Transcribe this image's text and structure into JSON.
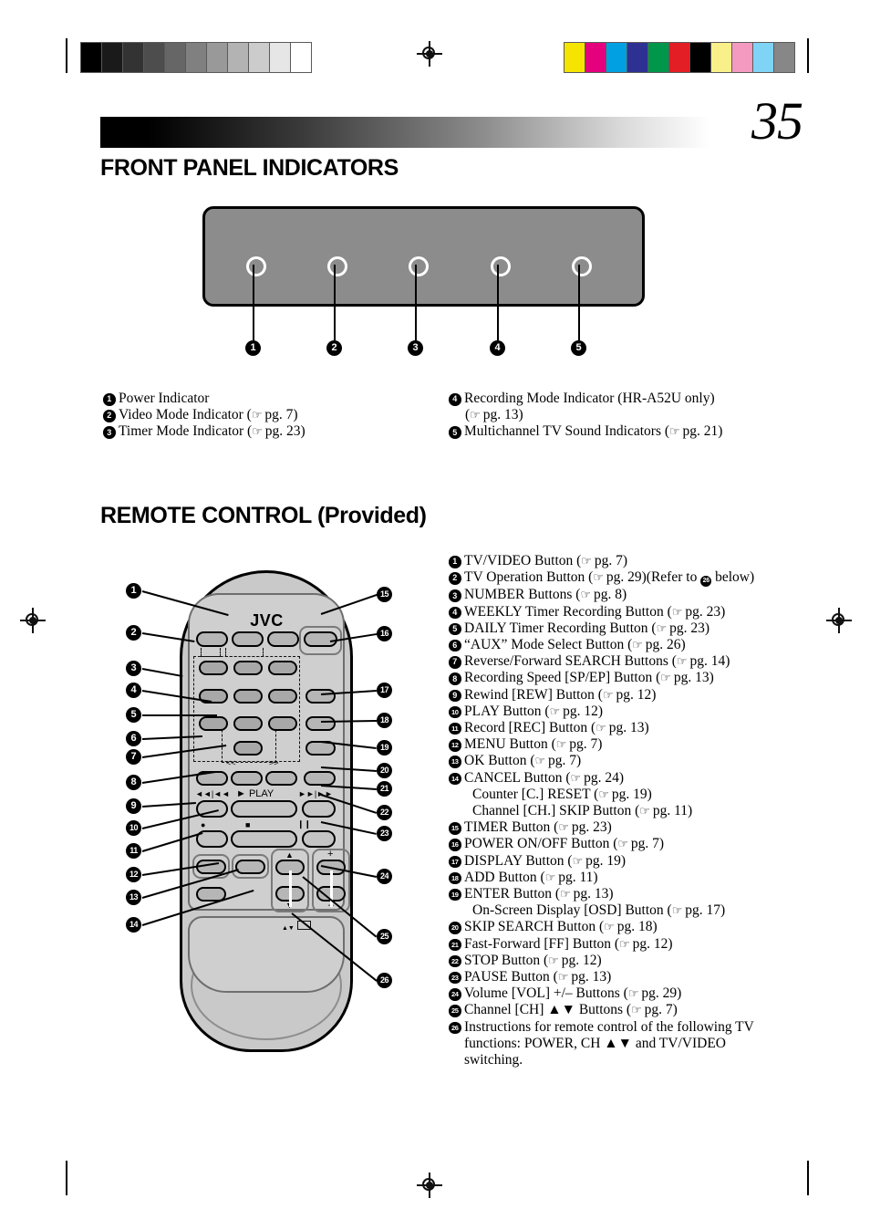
{
  "page": {
    "number": "35",
    "sections": {
      "front_panel_title": "FRONT PANEL INDICATORS",
      "remote_title": "REMOTE CONTROL (Provided)"
    }
  },
  "print_marks": {
    "gray_wedge": [
      "#000000",
      "#1a1a1a",
      "#333333",
      "#4d4d4d",
      "#666666",
      "#808080",
      "#999999",
      "#b3b3b3",
      "#cccccc",
      "#e6e6e6",
      "#ffffff"
    ],
    "color_bar": [
      "#f5e400",
      "#e5007d",
      "#00a0e3",
      "#2e3192",
      "#00974b",
      "#e31e24",
      "#000000",
      "#faf08a",
      "#f49ac1",
      "#7fd4f5",
      "#878787"
    ]
  },
  "front_panel": {
    "callouts": [
      "1",
      "2",
      "3",
      "4",
      "5"
    ],
    "items_left": [
      {
        "num": "1",
        "text": "Power Indicator",
        "ref": ""
      },
      {
        "num": "2",
        "text": "Video Mode Indicator",
        "ref": "pg. 7"
      },
      {
        "num": "3",
        "text": "Timer Mode Indicator",
        "ref": "pg. 23"
      }
    ],
    "items_right": [
      {
        "num": "4",
        "text": "Recording Mode Indicator (HR-A52U only)",
        "ref": "pg. 13",
        "ref_on_new_line": true
      },
      {
        "num": "5",
        "text": "Multichannel TV Sound Indicators",
        "ref": "pg. 21"
      }
    ]
  },
  "remote": {
    "brand": "JVC",
    "markings": {
      "search_left": "<<",
      "search_right": ">>",
      "rew": "◄◄|◄◄",
      "play": "► PLAY",
      "ff": "►►|►►",
      "rec": "●",
      "stop": "■",
      "pause": "❙❙",
      "ch_up": "▲",
      "ch_down": "▼",
      "vol_plus": "+",
      "vol_minus": "–",
      "tv_hint": "▲▼"
    },
    "callouts_left": [
      "1",
      "2",
      "3",
      "4",
      "5",
      "6",
      "7",
      "8",
      "9",
      "10",
      "11",
      "12",
      "13",
      "14"
    ],
    "callouts_right": [
      "15",
      "16",
      "17",
      "18",
      "19",
      "20",
      "21",
      "22",
      "23",
      "24",
      "25",
      "26"
    ],
    "items": [
      {
        "num": "1",
        "text": "TV/VIDEO Button",
        "ref": "pg. 7"
      },
      {
        "num": "2",
        "text": "TV Operation Button",
        "ref": "pg. 29",
        "suffix": "(Refer to",
        "inline_badge": "26",
        "suffix2": "below)"
      },
      {
        "num": "3",
        "text": "NUMBER Buttons",
        "ref": "pg. 8"
      },
      {
        "num": "4",
        "text": "WEEKLY Timer Recording Button",
        "ref": "pg. 23"
      },
      {
        "num": "5",
        "text": "DAILY Timer Recording Button",
        "ref": "pg. 23"
      },
      {
        "num": "6",
        "text": "“AUX” Mode Select Button",
        "ref": "pg. 26"
      },
      {
        "num": "7",
        "text": "Reverse/Forward SEARCH Buttons",
        "ref": "pg. 14"
      },
      {
        "num": "8",
        "text": "Recording Speed [SP/EP] Button",
        "ref": "pg. 13"
      },
      {
        "num": "9",
        "text": "Rewind [REW] Button",
        "ref": "pg. 12"
      },
      {
        "num": "10",
        "text": "PLAY Button",
        "ref": "pg. 12"
      },
      {
        "num": "11",
        "text": "Record [REC] Button",
        "ref": "pg. 13"
      },
      {
        "num": "12",
        "text": "MENU Button",
        "ref": "pg. 7"
      },
      {
        "num": "13",
        "text": "OK Button",
        "ref": "pg. 7"
      },
      {
        "num": "14",
        "text": "CANCEL Button",
        "ref": "pg. 24",
        "sublines": [
          {
            "text": "Counter [C.] RESET",
            "ref": "pg. 19"
          },
          {
            "text": "Channel [CH.] SKIP Button",
            "ref": "pg. 11"
          }
        ]
      },
      {
        "num": "15",
        "text": "TIMER Button",
        "ref": "pg. 23"
      },
      {
        "num": "16",
        "text": "POWER ON/OFF Button",
        "ref": "pg. 7"
      },
      {
        "num": "17",
        "text": "DISPLAY Button",
        "ref": "pg. 19"
      },
      {
        "num": "18",
        "text": "ADD Button",
        "ref": "pg. 11"
      },
      {
        "num": "19",
        "text": "ENTER Button",
        "ref": "pg. 13",
        "sublines": [
          {
            "text": "On-Screen Display [OSD] Button",
            "ref": "pg. 17"
          }
        ]
      },
      {
        "num": "20",
        "text": "SKIP SEARCH Button",
        "ref": "pg. 18"
      },
      {
        "num": "21",
        "text": "Fast-Forward [FF] Button",
        "ref": "pg. 12"
      },
      {
        "num": "22",
        "text": "STOP Button",
        "ref": "pg. 12"
      },
      {
        "num": "23",
        "text": "PAUSE Button",
        "ref": "pg. 13"
      },
      {
        "num": "24",
        "text": "Volume [VOL] +/– Buttons",
        "ref": "pg. 29"
      },
      {
        "num": "25",
        "text": "Channel [CH] ▲▼ Buttons",
        "ref": "pg. 7"
      },
      {
        "num": "26",
        "text": "Instructions for remote control of the following TV functions: POWER, CH ▲▼ and TV/VIDEO switching.",
        "ref": "",
        "wrap": true
      }
    ]
  }
}
